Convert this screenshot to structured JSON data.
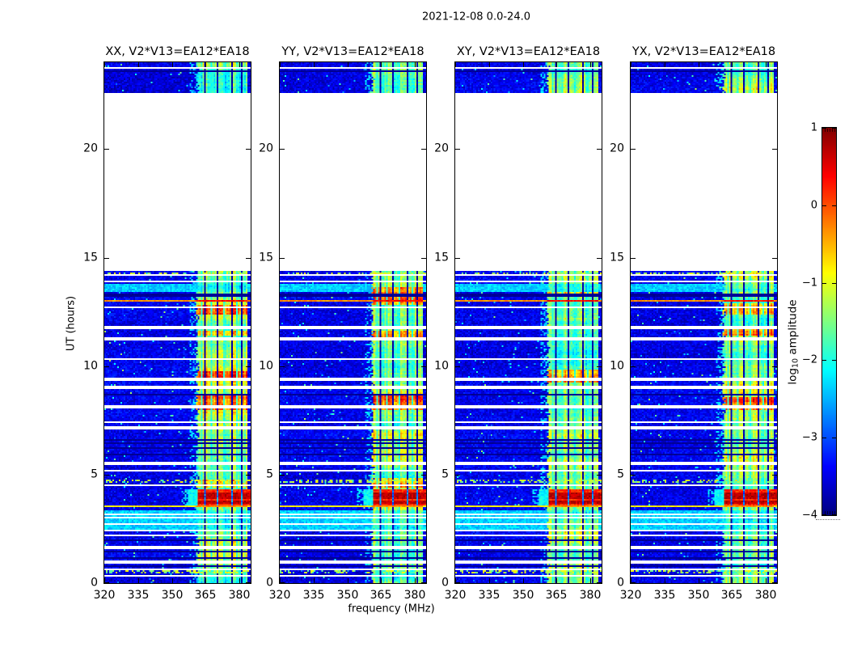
{
  "figure": {
    "background": "#ffffff"
  },
  "chart_data": {
    "type": "heatmap",
    "title": "2021-12-08 0.0-24.0",
    "xlabel": "frequency (MHz)",
    "ylabel": "UT (hours)",
    "x_range": [
      320,
      385
    ],
    "x_ticks": [
      "320",
      "335",
      "350",
      "365",
      "380"
    ],
    "x_tick_values": [
      320,
      335,
      350,
      365,
      380
    ],
    "y_range": [
      0,
      24
    ],
    "y_ticks": [
      "0",
      "5",
      "10",
      "15",
      "20"
    ],
    "y_tick_values": [
      0,
      5,
      10,
      15,
      20
    ],
    "grid": false,
    "colorbar": {
      "label_prefix": "log",
      "label_sub": "10",
      "label_suffix": " amplitude",
      "range": [
        -4,
        1
      ],
      "ticks": [
        "1",
        "0",
        "−1",
        "−2",
        "−3",
        "−4"
      ],
      "tick_values": [
        1,
        0,
        -1,
        -2,
        -3,
        -4
      ],
      "colormap": "jet"
    },
    "panels": [
      {
        "pol": "XX",
        "title": "XX, V2*V13=EA12*EA18",
        "seed": 11,
        "band_adj": 0,
        "band_hot": [
          [
            4.38,
            4.8
          ],
          [
            8.0,
            8.62
          ],
          [
            9.3,
            9.75
          ],
          [
            11.4,
            11.65
          ],
          [
            12.35,
            12.8
          ]
        ]
      },
      {
        "pol": "YY",
        "title": "YY, V2*V13=EA12*EA18",
        "seed": 23,
        "band_adj": 0.05,
        "band_hot": [
          [
            4.38,
            4.85
          ],
          [
            8.0,
            8.65
          ],
          [
            11.3,
            11.6
          ],
          [
            12.8,
            13.66
          ]
        ]
      },
      {
        "pol": "XY",
        "title": "XY, V2*V13=EA12*EA18",
        "seed": 37,
        "band_adj": -0.12,
        "band_hot": [
          [
            9.25,
            9.85
          ],
          [
            13.3,
            13.45
          ]
        ]
      },
      {
        "pol": "YX",
        "title": "YX, V2*V13=EA12*EA18",
        "seed": 51,
        "band_adj": 0,
        "band_hot": [
          [
            8.0,
            8.6
          ],
          [
            11.4,
            11.7
          ],
          [
            12.35,
            12.9
          ]
        ]
      }
    ],
    "spectrogram": {
      "noise_floor": -3.75,
      "no_data_interval": [
        14.35,
        22.55
      ],
      "rfi_band": {
        "f_start": 361.2,
        "f_end": 383.6,
        "level": -1.45,
        "notches": [
          364.6,
          370.6,
          376.6,
          381.2
        ],
        "notch_width": 0.7,
        "minor_notches": [
          363.2,
          367.6,
          373.4,
          378.9
        ]
      },
      "white_rows": [
        23.74,
        14.2,
        13.9,
        12.7,
        11.78,
        11.25,
        10.32,
        9.39,
        9.02,
        8.12,
        7.42,
        7.16,
        5.52,
        5.18,
        4.51,
        3.17,
        3.02,
        2.72,
        2.42,
        2.2,
        1.64,
        0.97,
        0.65,
        0.33
      ],
      "black_rows": [
        23.58,
        13.34,
        13.2,
        8.68,
        6.63,
        6.48,
        6.19,
        5.89,
        1.97,
        1.42,
        1.16,
        0.78
      ],
      "orange_rows": [
        12.98
      ],
      "yellow_rows": [
        3.52
      ],
      "speckle_rows": [
        14.28,
        4.68,
        0.5
      ],
      "cyan_bands": [
        [
          2.35,
          3.32
        ],
        [
          13.45,
          13.82
        ]
      ],
      "red_event": {
        "t_start": 3.58,
        "t_end": 4.3,
        "f_start": 357.5,
        "sub_rows": [
          [
            3.63,
            3.78
          ],
          [
            3.85,
            4.0
          ],
          [
            4.06,
            4.21
          ]
        ]
      }
    }
  }
}
